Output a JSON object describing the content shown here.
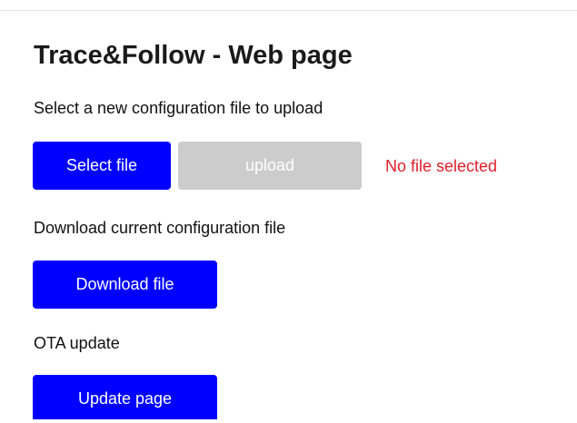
{
  "page": {
    "title": "Trace&Follow - Web page"
  },
  "upload_section": {
    "label": "Select a new configuration file to upload",
    "select_button": "Select file",
    "upload_button": "upload",
    "status": "No file selected"
  },
  "download_section": {
    "label": "Download current configuration file",
    "download_button": "Download file"
  },
  "ota_section": {
    "label": "OTA update",
    "update_button": "Update page"
  },
  "colors": {
    "primary_button": "#0000ff",
    "disabled_button": "#cccccc",
    "status_error": "#e0202a"
  }
}
